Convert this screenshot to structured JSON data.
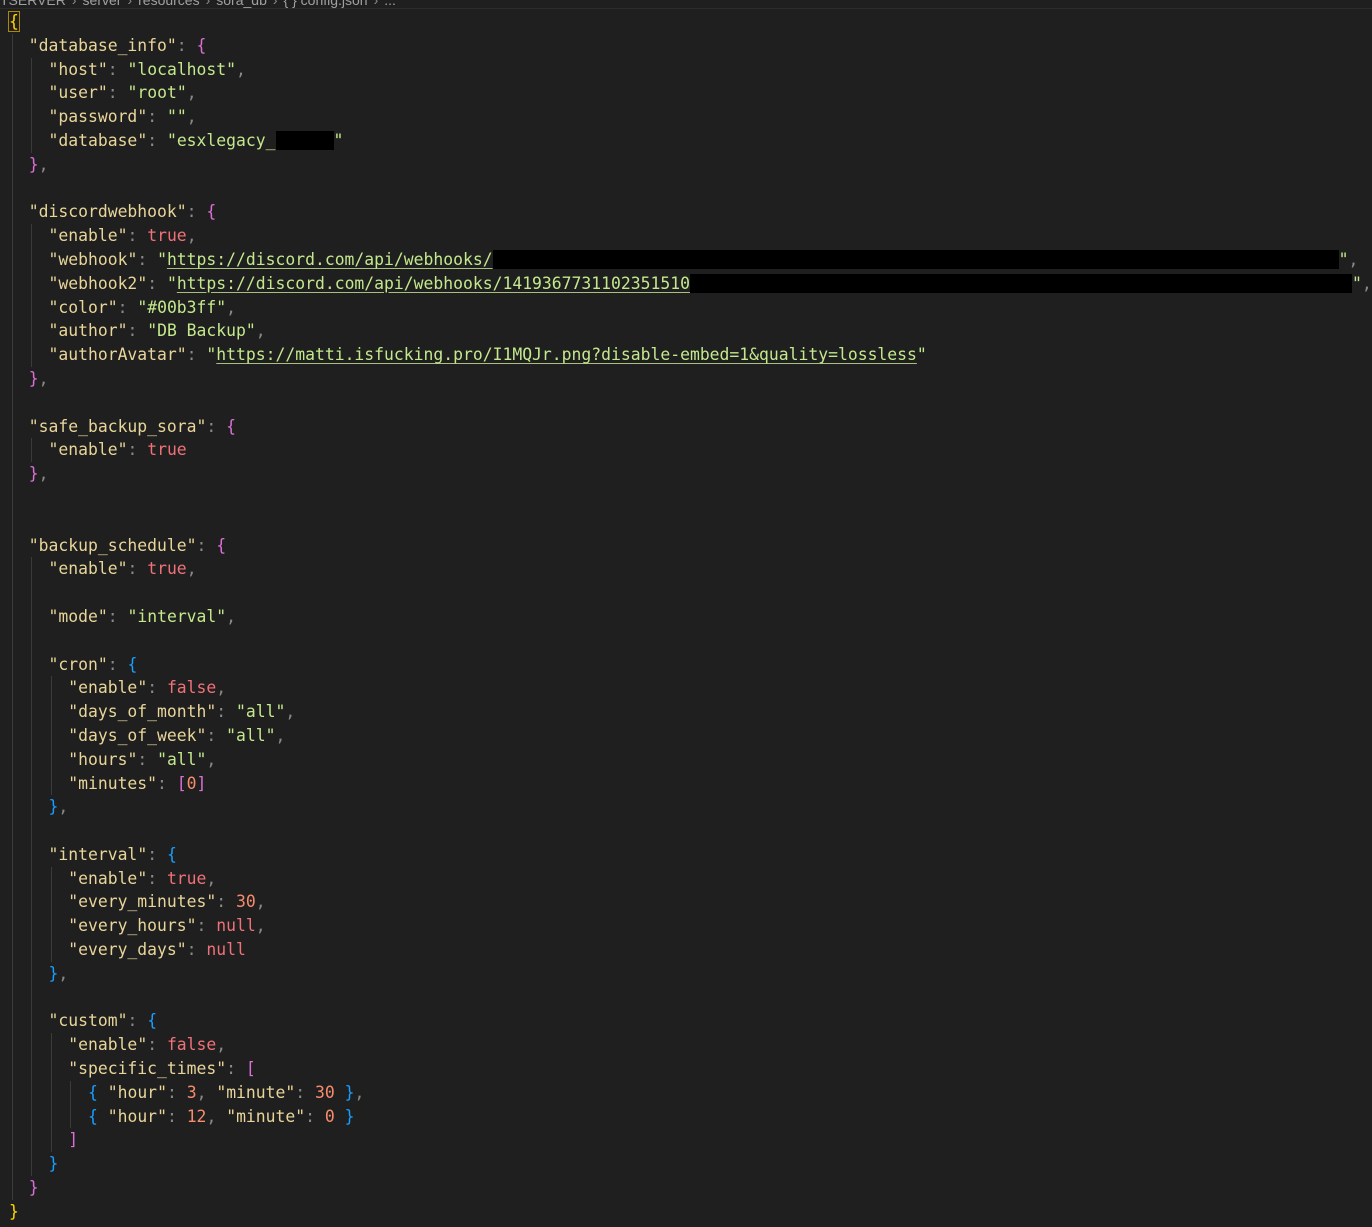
{
  "breadcrumb": {
    "items": [
      "TSERVER",
      "server",
      "resources",
      "sora_db",
      "{ } config.json",
      "..."
    ]
  },
  "config": {
    "database_info_key": "database_info",
    "host_key": "host",
    "host_val": "localhost",
    "user_key": "user",
    "user_val": "root",
    "password_key": "password",
    "password_val": "",
    "database_key": "database",
    "database_val": "esxlegacy_",
    "discord_key": "discordwebhook",
    "enable_key": "enable",
    "true_val": "true",
    "false_val": "false",
    "null_val": "null",
    "webhook_key": "webhook",
    "webhook_val": "https://discord.com/api/webhooks/",
    "webhook2_key": "webhook2",
    "webhook2_val": "https://discord.com/api/webhooks/1419367731102351510",
    "color_key": "color",
    "color_val": "#00b3ff",
    "author_key": "author",
    "author_val": "DB Backup",
    "avatar_key": "authorAvatar",
    "avatar_val": "https://matti.isfucking.pro/I1MQJr.png?disable-embed=1&quality=lossless",
    "safe_key": "safe_backup_sora",
    "schedule_key": "backup_schedule",
    "mode_key": "mode",
    "mode_val": "interval",
    "cron_key": "cron",
    "dom_key": "days_of_month",
    "all_val": "all",
    "dow_key": "days_of_week",
    "hours_key": "hours",
    "minutes_key": "minutes",
    "minutes_val": "0",
    "interval_key": "interval",
    "every_minutes_key": "every_minutes",
    "every_minutes_val": "30",
    "every_hours_key": "every_hours",
    "every_days_key": "every_days",
    "custom_key": "custom",
    "specific_times_key": "specific_times",
    "hour_key": "hour",
    "minute_key": "minute",
    "t1_hour": "3",
    "t1_minute": "30",
    "t2_hour": "12",
    "t2_minute": "0"
  },
  "colors": {
    "background": "#1f1f1f",
    "key": "#e8d59a",
    "string": "#c3e88d",
    "boolean": "#f07178",
    "number": "#f78c6c",
    "bracket_gold": "#ffd700",
    "bracket_purple": "#da70d6",
    "bracket_blue": "#179fff"
  }
}
